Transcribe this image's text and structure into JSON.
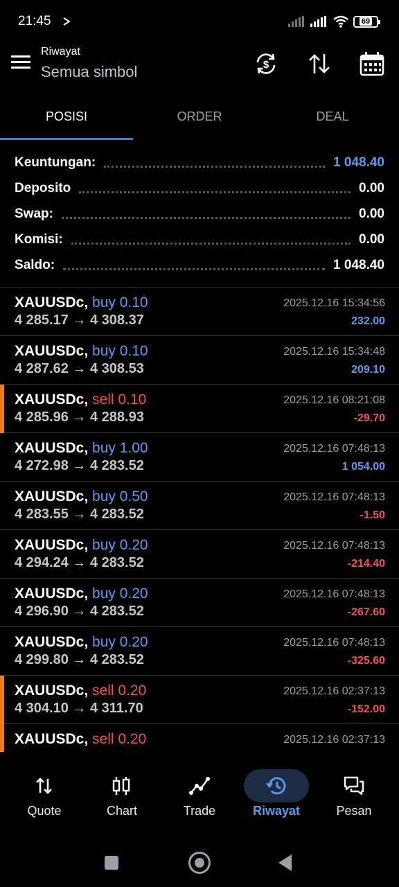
{
  "status_bar": {
    "time": "21:45",
    "battery": "69"
  },
  "header": {
    "title_small": "Riwayat",
    "title_big": "Semua simbol"
  },
  "tabs": [
    {
      "label": "POSISI",
      "active": true
    },
    {
      "label": "ORDER",
      "active": false
    },
    {
      "label": "DEAL",
      "active": false
    }
  ],
  "summary": [
    {
      "label": "Keuntungan:",
      "value": "1 048.40",
      "accent": true
    },
    {
      "label": "Deposito",
      "value": "0.00",
      "accent": false
    },
    {
      "label": "Swap:",
      "value": "0.00",
      "accent": false
    },
    {
      "label": "Komisi:",
      "value": "0.00",
      "accent": false
    },
    {
      "label": "Saldo:",
      "value": "1 048.40",
      "accent": false
    }
  ],
  "deals": [
    {
      "symbol": "XAUUSDc,",
      "side": "buy",
      "volume": "buy 0.10",
      "prices": "4 285.17 → 4 308.37",
      "time": "2025.12.16 15:34:56",
      "profit": "232.00",
      "marker": false
    },
    {
      "symbol": "XAUUSDc,",
      "side": "buy",
      "volume": "buy 0.10",
      "prices": "4 287.62 → 4 308.53",
      "time": "2025.12.16 15:34:48",
      "profit": "209.10",
      "marker": false
    },
    {
      "symbol": "XAUUSDc,",
      "side": "sell",
      "volume": "sell 0.10",
      "prices": "4 285.96 → 4 288.93",
      "time": "2025.12.16 08:21:08",
      "profit": "-29.70",
      "marker": true
    },
    {
      "symbol": "XAUUSDc,",
      "side": "buy",
      "volume": "buy 1.00",
      "prices": "4 272.98 → 4 283.52",
      "time": "2025.12.16 07:48:13",
      "profit": "1 054.00",
      "marker": false
    },
    {
      "symbol": "XAUUSDc,",
      "side": "buy",
      "volume": "buy 0.50",
      "prices": "4 283.55 → 4 283.52",
      "time": "2025.12.16 07:48:13",
      "profit": "-1.50",
      "marker": false
    },
    {
      "symbol": "XAUUSDc,",
      "side": "buy",
      "volume": "buy 0.20",
      "prices": "4 294.24 → 4 283.52",
      "time": "2025.12.16 07:48:13",
      "profit": "-214.40",
      "marker": false
    },
    {
      "symbol": "XAUUSDc,",
      "side": "buy",
      "volume": "buy 0.20",
      "prices": "4 296.90 → 4 283.52",
      "time": "2025.12.16 07:48:13",
      "profit": "-267.60",
      "marker": false
    },
    {
      "symbol": "XAUUSDc,",
      "side": "buy",
      "volume": "buy 0.20",
      "prices": "4 299.80 → 4 283.52",
      "time": "2025.12.16 07:48:13",
      "profit": "-325.60",
      "marker": false
    },
    {
      "symbol": "XAUUSDc,",
      "side": "sell",
      "volume": "sell 0.20",
      "prices": "4 304.10 → 4 311.70",
      "time": "2025.12.16 02:37:13",
      "profit": "-152.00",
      "marker": true
    },
    {
      "symbol": "XAUUSDc,",
      "side": "sell",
      "volume": "sell 0.20",
      "prices": "",
      "time": "2025.12.16 02:37:13",
      "profit": "",
      "marker": true
    }
  ],
  "bottom_nav": [
    {
      "label": "Quote",
      "icon": "quote-icon",
      "active": false
    },
    {
      "label": "Chart",
      "icon": "chart-icon",
      "active": false
    },
    {
      "label": "Trade",
      "icon": "trade-icon",
      "active": false
    },
    {
      "label": "Riwayat",
      "icon": "history-icon",
      "active": true
    },
    {
      "label": "Pesan",
      "icon": "messages-icon",
      "active": false
    }
  ],
  "colors": {
    "accent": "#5b9cf0",
    "negative": "#ef5350",
    "marker": "#ef7b22",
    "background": "#000000"
  }
}
